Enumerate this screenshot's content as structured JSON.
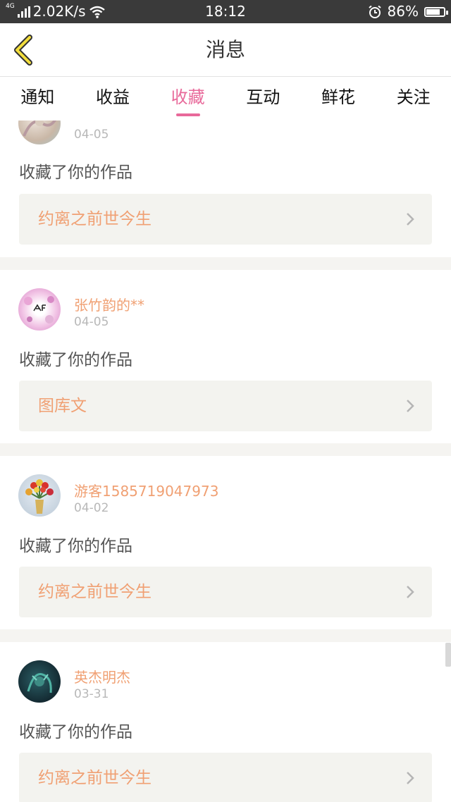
{
  "status_bar": {
    "network": "4G",
    "speed": "2.02K/s",
    "time": "18:12",
    "battery": "86%",
    "battery_level": 0.86
  },
  "header": {
    "title": "消息"
  },
  "tabs": [
    {
      "label": "通知",
      "active": false
    },
    {
      "label": "收益",
      "active": false
    },
    {
      "label": "收藏",
      "active": true
    },
    {
      "label": "互动",
      "active": false
    },
    {
      "label": "鲜花",
      "active": false
    },
    {
      "label": "关注",
      "active": false
    }
  ],
  "messages": [
    {
      "username": "",
      "date": "04-05",
      "action": "收藏了你的作品",
      "work": "约离之前世今生"
    },
    {
      "username": "张竹韵的**",
      "date": "04-05",
      "action": "收藏了你的作品",
      "work": "图库文"
    },
    {
      "username": "游客1585719047973",
      "date": "04-02",
      "action": "收藏了你的作品",
      "work": "约离之前世今生"
    },
    {
      "username": "英杰明杰",
      "date": "03-31",
      "action": "收藏了你的作品",
      "work": "约离之前世今生"
    }
  ],
  "colors": {
    "accent": "#e8699a",
    "username": "#f0a073",
    "background": "#f5f4f1"
  }
}
